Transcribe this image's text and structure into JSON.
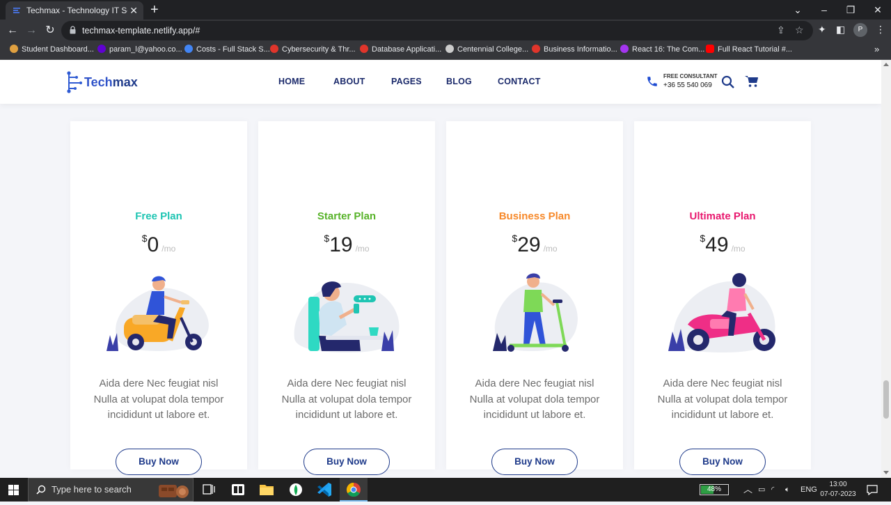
{
  "browser": {
    "tab_title": "Techmax - Technology IT Solution",
    "tab_close": "✕",
    "new_tab": "+",
    "url": "techmax-template.netlify.app/#",
    "bookmarks": [
      {
        "label": "Student Dashboard...",
        "color": "#e0a040"
      },
      {
        "label": "param_l@yahoo.co...",
        "color": "#6001d2"
      },
      {
        "label": "Costs - Full Stack S...",
        "color": "#4285f4"
      },
      {
        "label": "Cybersecurity & Thr...",
        "color": "#e0352b"
      },
      {
        "label": "Database Applicati...",
        "color": "#e0352b"
      },
      {
        "label": "Centennial College...",
        "color": "#cccccc"
      },
      {
        "label": "Business Informatio...",
        "color": "#e0352b"
      },
      {
        "label": "React 16: The Com...",
        "color": "#a435f0"
      },
      {
        "label": "Full React Tutorial #...",
        "color": "#ff0000"
      }
    ],
    "bookmarks_more": "»",
    "profile_initial": "P"
  },
  "site": {
    "logo_text_1": "Tech",
    "logo_text_2": "max",
    "nav": [
      "HOME",
      "ABOUT",
      "PAGES",
      "BLOG",
      "CONTACT"
    ],
    "consult_label": "FREE CONSULTANT",
    "consult_phone": "+36 55 540 069"
  },
  "plans": [
    {
      "name": "Free Plan",
      "color": "#1fc5b3",
      "currency": "$",
      "price": "0",
      "period": "/mo",
      "desc": "Aida dere Nec feugiat nisl Nulla at volupat dola tempor incididunt ut labore et.",
      "button": "Buy Now",
      "illustration": "scooter-rider-icon"
    },
    {
      "name": "Starter Plan",
      "color": "#58b32a",
      "currency": "$",
      "price": "19",
      "period": "/mo",
      "desc": "Aida dere Nec feugiat nisl Nulla at volupat dola tempor incididunt ut labore et.",
      "button": "Buy Now",
      "illustration": "desk-worker-icon"
    },
    {
      "name": "Business Plan",
      "color": "#f7892a",
      "currency": "$",
      "price": "29",
      "period": "/mo",
      "desc": "Aida dere Nec feugiat nisl Nulla at volupat dola tempor incididunt ut labore et.",
      "button": "Buy Now",
      "illustration": "kick-scooter-icon"
    },
    {
      "name": "Ultimate Plan",
      "color": "#e8196f",
      "currency": "$",
      "price": "49",
      "period": "/mo",
      "desc": "Aida dere Nec feugiat nisl Nulla at volupat dola tempor incididunt ut labore et.",
      "button": "Buy Now",
      "illustration": "motorbike-rider-icon"
    }
  ],
  "taskbar": {
    "search_placeholder": "Type here to search",
    "battery": "48%",
    "battery_level": 0.48,
    "lang": "ENG",
    "time": "13:00",
    "date": "07-07-2023"
  }
}
